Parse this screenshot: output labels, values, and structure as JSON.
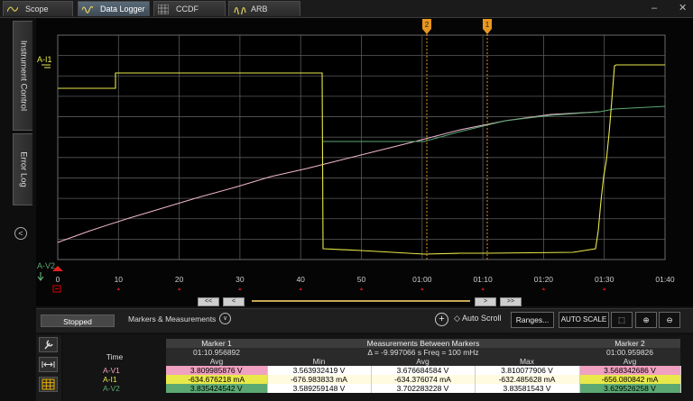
{
  "tabs": [
    {
      "label": "Scope",
      "icon": "scope-wave-icon"
    },
    {
      "label": "Data Logger",
      "icon": "datalogger-wave-icon"
    },
    {
      "label": "CCDF",
      "icon": "ccdf-grid-icon"
    },
    {
      "label": "ARB",
      "icon": "arb-wave-icon"
    }
  ],
  "window": {
    "minimize": "–",
    "close": "✕"
  },
  "sidebar": {
    "instrument_control": "Instrument Control",
    "error_log": "Error Log",
    "collapse": "<"
  },
  "chart": {
    "x_ticks": [
      "0",
      "10",
      "20",
      "30",
      "40",
      "50",
      "01:00",
      "01:10",
      "01:20",
      "01:30",
      "01:40"
    ],
    "trace_labels": {
      "current": "A-I1",
      "voltage": "A-V2"
    },
    "marker_labels": [
      "2",
      "1"
    ],
    "colors": {
      "current": "#e8e84a",
      "voltage1": "#f0b8d0",
      "voltage2": "#5ca873",
      "marker": "#e8961e"
    }
  },
  "scroll": {
    "first": "<<",
    "prev": "<",
    "next": ">",
    "last": ">>"
  },
  "controls": {
    "status": "Stopped",
    "markers_label": "Markers & Measurements",
    "auto_scroll": "Auto Scroll",
    "ranges": "Ranges...",
    "auto_scale": "AUTO SCALE"
  },
  "measurements": {
    "marker1_title": "Marker 1",
    "marker1_time": "01:10.956892",
    "between_title": "Measurements Between Markers",
    "between_info": "Δ = -9.997066 s   Freq = 100 mHz",
    "marker2_title": "Marker 2",
    "marker2_time": "01:00.959826",
    "time_label": "Time",
    "avg_label": "Avg",
    "min_label": "Min",
    "max_label": "Max",
    "rows": [
      {
        "name": "A-V1",
        "color": "#f0a0c0",
        "m1": "3.809985876 V",
        "min": "3.563932419 V",
        "avg": "3.676684584 V",
        "max": "3.810077906 V",
        "m2": "3.568342686 V"
      },
      {
        "name": "A-I1",
        "color": "#e8e84a",
        "m1": "-634.676218 mA",
        "min": "-676.983833 mA",
        "avg": "-634.376074 mA",
        "max": "-632.485628 mA",
        "m2": "-656.080842 mA"
      },
      {
        "name": "A-V2",
        "color": "#5ca873",
        "m1": "3.835424542 V",
        "min": "3.589259148 V",
        "avg": "3.702283228 V",
        "max": "3.83581543 V",
        "m2": "3.629526258 V"
      }
    ]
  }
}
